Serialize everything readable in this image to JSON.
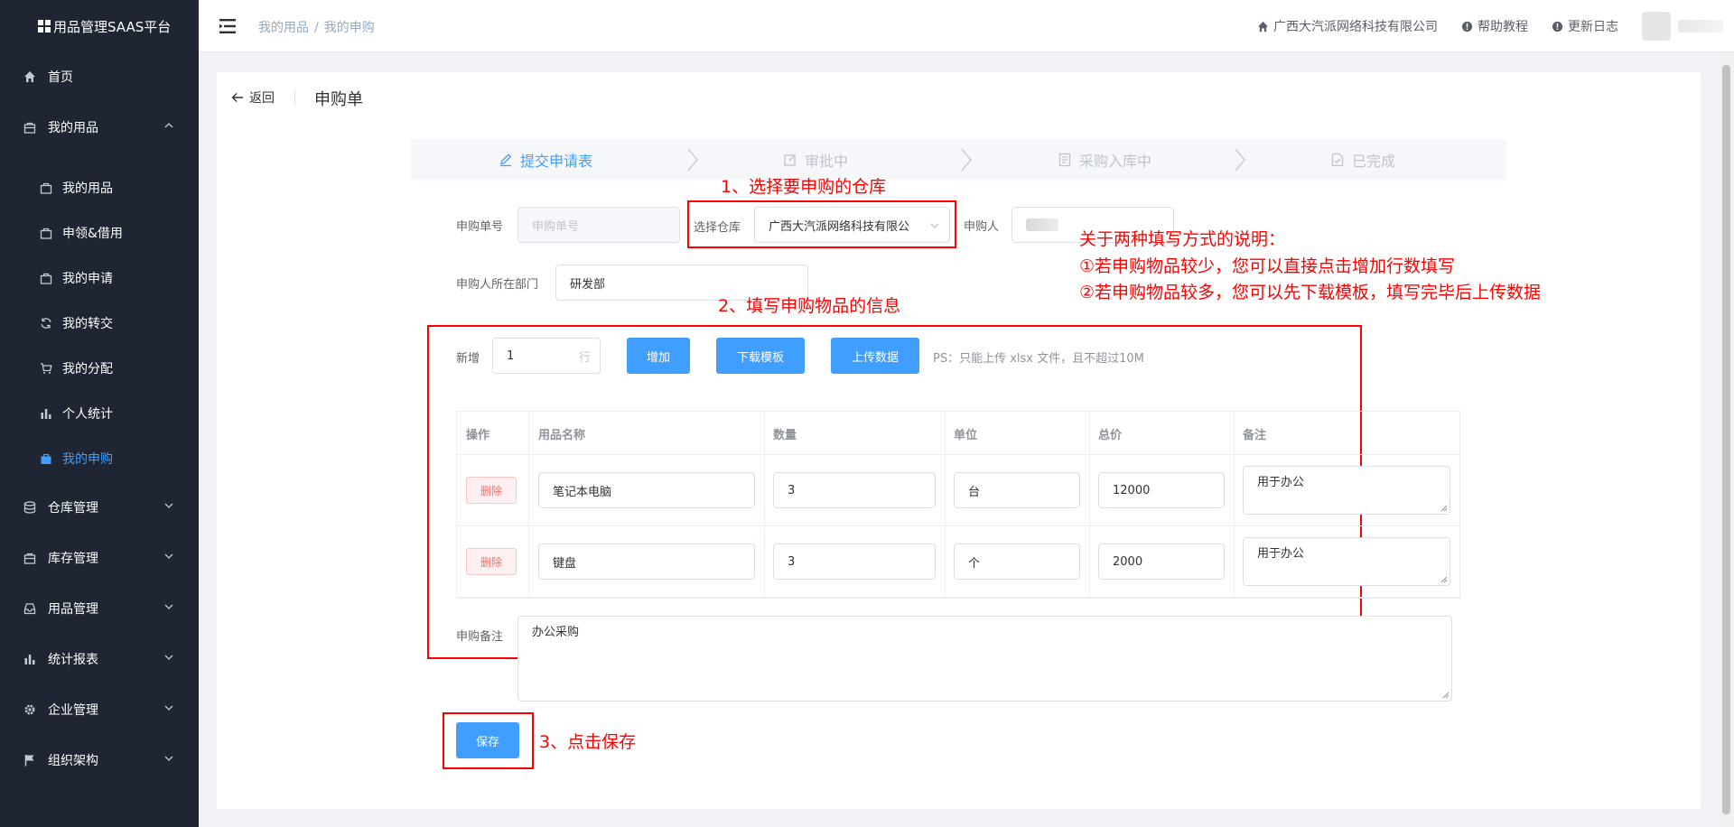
{
  "app": {
    "title": "用品管理SAAS平台"
  },
  "sidebar": {
    "items": [
      {
        "label": "首页",
        "icon": "home-icon"
      },
      {
        "label": "我的用品",
        "icon": "bag-icon",
        "expanded": true
      },
      {
        "label": "仓库管理",
        "icon": "database-icon"
      },
      {
        "label": "库存管理",
        "icon": "bag-icon"
      },
      {
        "label": "用品管理",
        "icon": "tray-icon"
      },
      {
        "label": "统计报表",
        "icon": "bar-chart-icon"
      },
      {
        "label": "企业管理",
        "icon": "gear-icon"
      },
      {
        "label": "组织架构",
        "icon": "flag-icon"
      }
    ],
    "sub_items": [
      {
        "label": "我的用品",
        "icon": "bag-icon"
      },
      {
        "label": "申领&借用",
        "icon": "bag-icon"
      },
      {
        "label": "我的申请",
        "icon": "bag-icon"
      },
      {
        "label": "我的转交",
        "icon": "refresh-icon"
      },
      {
        "label": "我的分配",
        "icon": "cart-icon"
      },
      {
        "label": "个人统计",
        "icon": "bar-chart-icon"
      },
      {
        "label": "我的申购",
        "icon": "bag-icon",
        "active": true
      }
    ]
  },
  "header": {
    "breadcrumb": [
      "我的用品",
      "我的申购"
    ],
    "company": "广西大汽派网络科技有限公司",
    "help": "帮助教程",
    "changelog": "更新日志"
  },
  "page": {
    "back": "返回",
    "title": "申购单",
    "steps": [
      "提交申请表",
      "审批中",
      "采购入库中",
      "已完成"
    ],
    "active_step": 0
  },
  "form": {
    "order_no_label": "申购单号",
    "order_no_placeholder": "申购单号",
    "warehouse_label": "选择仓库",
    "warehouse_value": "广西大汽派网络科技有限公",
    "applicant_label": "申购人",
    "dept_label": "申购人所在部门",
    "dept_value": "研发部",
    "add_label": "新增",
    "add_count": "1",
    "add_unit": "行",
    "add_button": "增加",
    "download_button": "下载模板",
    "upload_button": "上传数据",
    "ps_note": "PS：只能上传 xlsx 文件，且不超过10M",
    "remark_label": "申购备注",
    "remark_value": "办公采购",
    "save_button": "保存"
  },
  "table": {
    "columns": [
      "操作",
      "用品名称",
      "数量",
      "单位",
      "总价",
      "备注"
    ],
    "delete_label": "删除",
    "rows": [
      {
        "name": "笔记本电脑",
        "qty": "3",
        "unit": "台",
        "total": "12000",
        "note": "用于办公"
      },
      {
        "name": "键盘",
        "qty": "3",
        "unit": "个",
        "total": "2000",
        "note": "用于办公"
      }
    ]
  },
  "annotations": {
    "step1": "1、选择要申购的仓库",
    "step2": "2、填写申购物品的信息",
    "step3": "3、点击保存",
    "note_title": "关于两种填写方式的说明：",
    "note_line1": "①若申购物品较少，您可以直接点击增加行数填写",
    "note_line2": "②若申购物品较多，您可以先下载模板，填写完毕后上传数据",
    "color": "#ff0000"
  },
  "colors": {
    "sidebar_bg": "#1f2532",
    "primary": "#409eff",
    "danger": "#f56c6c"
  }
}
